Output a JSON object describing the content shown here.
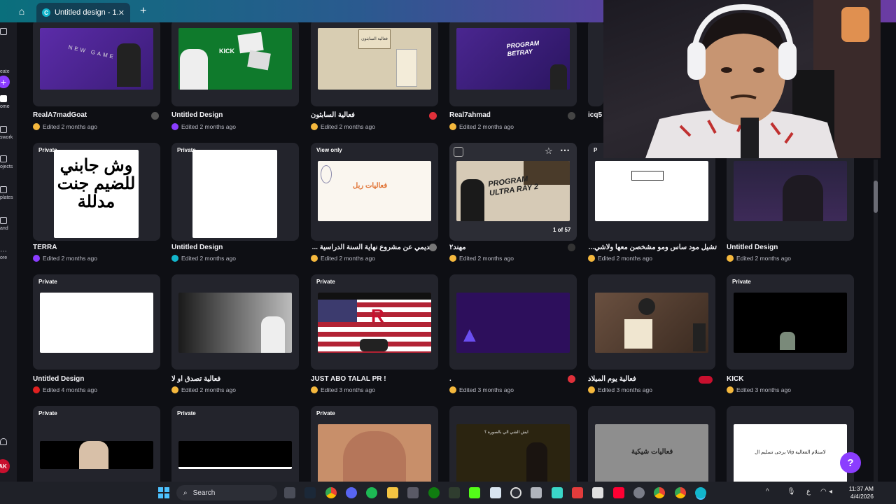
{
  "browser": {
    "tab_title": "Untitled design - 1...",
    "tab_favicon_letter": "C"
  },
  "rail": {
    "labels": [
      "eate",
      "ome",
      "swork",
      "ojects",
      "plates",
      "and",
      "ore"
    ],
    "avatar": "AK"
  },
  "cards": [
    {
      "title": "RealA7madGoat",
      "sub": "Edited 2 months ago",
      "badge": ""
    },
    {
      "title": "Untitled Design",
      "sub": "Edited 2 months ago",
      "badge": ""
    },
    {
      "title": "فعالية السابثون",
      "sub": "Edited 2 months ago",
      "badge": ""
    },
    {
      "title": "Real7ahmad",
      "sub": "Edited 2 months ago",
      "badge": ""
    },
    {
      "title": "icq5",
      "sub": "",
      "badge": ""
    },
    {
      "title": "TERRA",
      "sub": "Edited 2 months ago",
      "badge": "Private"
    },
    {
      "title": "Untitled Design",
      "sub": "Edited 2 months ago",
      "badge": "Private"
    },
    {
      "title": "تقديمي عن مشروع نهاية السنة الدراسية ...",
      "sub": "Edited 2 months ago",
      "badge": "View only"
    },
    {
      "title": "مهند٢",
      "sub": "Edited 2 months ago",
      "badge": "",
      "page_count": "1 of 57"
    },
    {
      "title": "تشيل مود ساس ومو مشخصن معها ولاشي...",
      "sub": "Edited 2 months ago",
      "badge": "P"
    },
    {
      "title": "Untitled Design",
      "sub": "Edited 2 months ago",
      "badge": ""
    },
    {
      "title": "Untitled Design",
      "sub": "Edited 4 months ago",
      "badge": "Private"
    },
    {
      "title": "فعالية تصدق او لا",
      "sub": "Edited 2 months ago",
      "badge": ""
    },
    {
      "title": "JUST ABO TALAL PR !",
      "sub": "Edited 3 months ago",
      "badge": "Private"
    },
    {
      "title": ".",
      "sub": "Edited 3 months ago",
      "badge": ""
    },
    {
      "title": "فعالية يوم الميلاد",
      "sub": "Edited 3 months ago",
      "badge": ""
    },
    {
      "title": "KICK",
      "sub": "Edited 3 months ago",
      "badge": "Private"
    },
    {
      "title": "",
      "sub": "",
      "badge": "Private"
    },
    {
      "title": "",
      "sub": "",
      "badge": "Private"
    },
    {
      "title": "",
      "sub": "",
      "badge": "Private"
    },
    {
      "title": "",
      "sub": "",
      "badge": ""
    },
    {
      "title": "",
      "sub": "",
      "badge": ""
    },
    {
      "title": "",
      "sub": "",
      "badge": ""
    }
  ],
  "thumb_text": {
    "terra": "وش جابني للضيم جنت مدللة",
    "sabthon": "فعالية السابثون",
    "rabel": "فعاليات ربل",
    "program": "PROGRAM ULTRA RAY 2",
    "betray": "PROGRAM BETRAY",
    "kick": "KICK",
    "new_game": "NEW GAME",
    "hamdi": "فعاليات شيكية",
    "vip": "يرجى تسليم ال Vip لاستلام الفعالية",
    "question": "ايش الشي الي بالصورة ؟"
  },
  "help_label": "?",
  "taskbar": {
    "search_placeholder": "Search",
    "time": "11:37 AM",
    "date": "4/4/2026",
    "lang": "ع"
  },
  "colors": {
    "accent": "#8b3dff",
    "card_bg": "#23242c",
    "page_bg": "#0e0f14"
  }
}
